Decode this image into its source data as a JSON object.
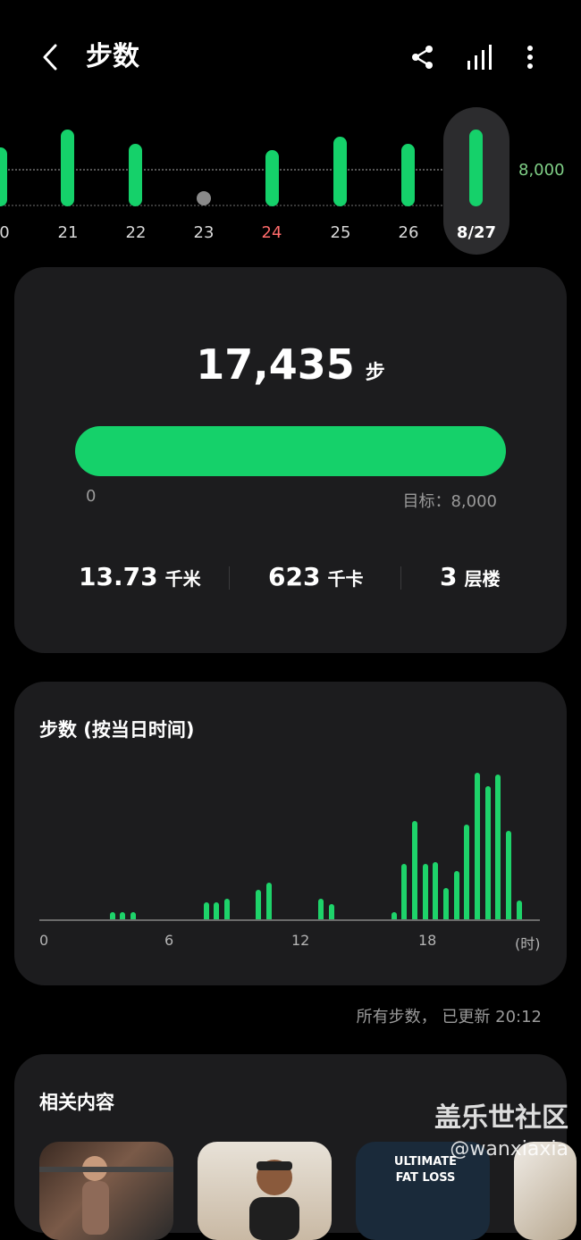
{
  "header": {
    "title": "步数",
    "share_icon": "share-icon",
    "chart_icon": "bar-chart-icon",
    "more_icon": "more-vertical-icon"
  },
  "week_strip": {
    "goal_label": "8,000",
    "days": [
      {
        "label": "0",
        "has_data": true
      },
      {
        "label": "21",
        "has_data": true
      },
      {
        "label": "22",
        "has_data": true
      },
      {
        "label": "23",
        "has_data": false
      },
      {
        "label": "24",
        "has_data": true,
        "highlight": true
      },
      {
        "label": "25",
        "has_data": true
      },
      {
        "label": "26",
        "has_data": true
      },
      {
        "label": "8/27",
        "has_data": true,
        "selected": true
      }
    ]
  },
  "summary": {
    "steps": "17,435",
    "steps_unit": "步",
    "progress": 1.0,
    "progress_min": "0",
    "progress_goal": "目标：8,000",
    "distance": "13.73",
    "distance_unit": "千米",
    "calories": "623",
    "calories_unit": "千卡",
    "floors": "3",
    "floors_unit": "层楼"
  },
  "hourly": {
    "title": "步数 (按当日时间)",
    "x_ticks": [
      "0",
      "6",
      "12",
      "18",
      "(时)"
    ]
  },
  "chart_data": {
    "type": "bar",
    "title": "步数 (按当日时间)",
    "xlabel": "(时)",
    "x_range": [
      0,
      24
    ],
    "x": [
      3.5,
      4.0,
      4.5,
      8.0,
      8.5,
      9.0,
      10.5,
      11.0,
      13.5,
      14.0,
      17.0,
      17.5,
      18.0,
      18.5,
      19.0,
      19.5,
      20.0,
      20.5,
      21.0,
      21.5,
      22.0,
      22.5,
      23.0
    ],
    "values": [
      4,
      4,
      4,
      9,
      9,
      11,
      16,
      20,
      11,
      8,
      4,
      30,
      53,
      30,
      31,
      17,
      26,
      51,
      79,
      72,
      78,
      48,
      10
    ]
  },
  "footer_note": "所有步数， 已更新 20:12",
  "related": {
    "title": "相关内容",
    "thumbs": [
      {
        "name": "thumb-1"
      },
      {
        "name": "thumb-2"
      },
      {
        "name": "thumb-3",
        "text": "ULTIMATE FAT LOSS"
      },
      {
        "name": "thumb-4"
      }
    ]
  },
  "watermark": {
    "line1": "盖乐世社区",
    "line2": "@wanxiaxia"
  },
  "colors": {
    "accent": "#15d16a",
    "card": "#1c1c1e",
    "highlight_day": "#ff6b6b"
  }
}
